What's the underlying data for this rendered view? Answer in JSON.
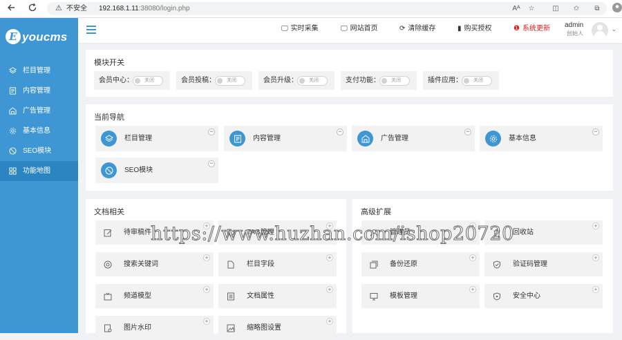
{
  "browser": {
    "security_label": "不安全",
    "url_host": "192.168.1.11",
    "url_rest": ":38080/login.php",
    "reader_label": "Aᴬ"
  },
  "brand": {
    "logo_text": "youcms",
    "logo_letter": "E"
  },
  "sidebar": {
    "items": [
      {
        "label": "栏目管理",
        "icon": "layers-icon"
      },
      {
        "label": "内容管理",
        "icon": "document-icon"
      },
      {
        "label": "广告管理",
        "icon": "ad-icon"
      },
      {
        "label": "基本信息",
        "icon": "gear-icon"
      },
      {
        "label": "SEO模块",
        "icon": "compass-icon"
      },
      {
        "label": "功能地图",
        "icon": "grid-icon"
      }
    ],
    "active_index": 5
  },
  "topbar": {
    "links": [
      {
        "label": "实时采集",
        "icon": "monitor-icon"
      },
      {
        "label": "网站首页",
        "icon": "monitor-icon"
      },
      {
        "label": "清除缓存",
        "icon": "refresh-icon"
      },
      {
        "label": "购买授权",
        "icon": "bookmark-icon"
      },
      {
        "label": "系统更新",
        "icon": "alert-icon",
        "color": "#e02020"
      }
    ],
    "user": {
      "name": "admin",
      "role": "创始人"
    }
  },
  "modules": {
    "title": "模块开关",
    "items": [
      {
        "label": "会员中心：",
        "state": "关闭"
      },
      {
        "label": "会员投稿：",
        "state": "关闭"
      },
      {
        "label": "会员升级：",
        "state": "关闭"
      },
      {
        "label": "支付功能：",
        "state": "关闭"
      },
      {
        "label": "插件应用：",
        "state": "关闭"
      }
    ]
  },
  "current_nav": {
    "title": "当前导航",
    "items": [
      {
        "label": "栏目管理",
        "icon": "layers-icon"
      },
      {
        "label": "内容管理",
        "icon": "document-icon"
      },
      {
        "label": "广告管理",
        "icon": "ad-icon"
      },
      {
        "label": "基本信息",
        "icon": "gear-icon"
      },
      {
        "label": "SEO模块",
        "icon": "compass-icon"
      }
    ],
    "remove_glyph": "−"
  },
  "docs": {
    "title": "文档相关",
    "items": [
      {
        "label": "待审稿件",
        "icon": "edit-icon"
      },
      {
        "label": "TAG管理",
        "icon": "tag-icon"
      },
      {
        "label": "搜索关键词",
        "icon": "target-icon"
      },
      {
        "label": "栏目字段",
        "icon": "file-icon"
      },
      {
        "label": "频道模型",
        "icon": "tv-icon"
      },
      {
        "label": "文档属性",
        "icon": "list-icon"
      },
      {
        "label": "图片水印",
        "icon": "image-file-icon"
      },
      {
        "label": "缩略图设置",
        "icon": "picture-icon"
      }
    ],
    "add_glyph": "+"
  },
  "advanced": {
    "title": "高级扩展",
    "items": [
      {
        "label": "管理员",
        "icon": "user-icon"
      },
      {
        "label": "回收站",
        "icon": "trash-icon"
      },
      {
        "label": "备份还原",
        "icon": "backup-icon"
      },
      {
        "label": "验证码管理",
        "icon": "shield-icon"
      },
      {
        "label": "模板管理",
        "icon": "monitor-icon"
      },
      {
        "label": "安全中心",
        "icon": "security-icon"
      }
    ],
    "add_glyph": "+"
  },
  "watermark": "https://www.huzhan.com/ishop20720",
  "colors": {
    "primary": "#3e97d4",
    "sidebar_active": "#2b85c2",
    "danger": "#e02020"
  }
}
